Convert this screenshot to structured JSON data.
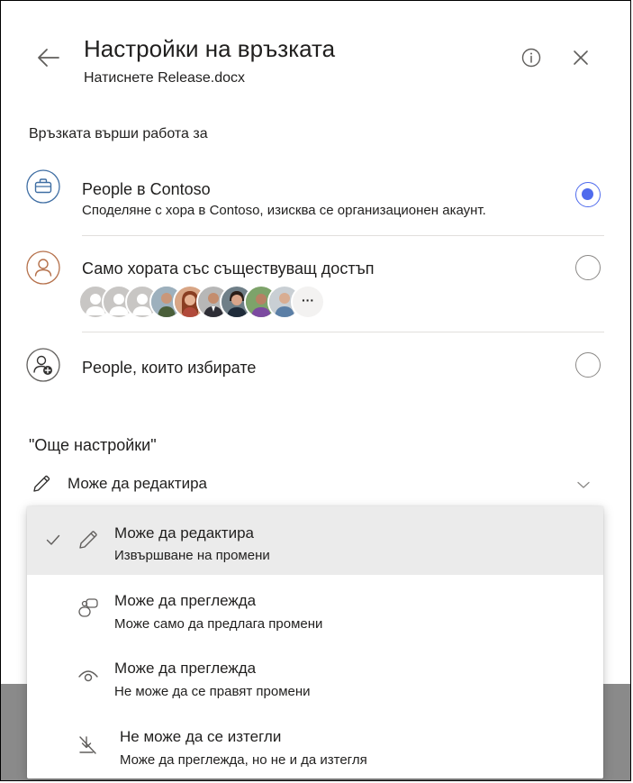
{
  "dialog": {
    "title": "Настройки на връзката",
    "subtitle": "Натиснете Release.docx",
    "back_icon": "arrow-left-icon",
    "info_icon": "info-icon",
    "close_icon": "close-icon"
  },
  "link_works_for": {
    "label": "Връзката върши работа за",
    "options": [
      {
        "icon": "briefcase-icon",
        "title": "People в Contoso",
        "description": "Споделяне с хора в Contoso, изисква се организационен акаунт.",
        "selected": true
      },
      {
        "icon": "person-icon",
        "title": "Само хората със съществуващ достъп",
        "description": "",
        "selected": false,
        "avatars": [
          "placeholder",
          "placeholder",
          "placeholder",
          "person",
          "person",
          "person",
          "person",
          "person",
          "person",
          "more"
        ],
        "more_label": "···"
      },
      {
        "icon": "person-add-icon",
        "title": "People, които избирате",
        "description": "",
        "selected": false
      }
    ]
  },
  "more_settings": {
    "label": "\"Още настройки\"",
    "permission_icon": "pencil-icon",
    "permission_value": "Може да редактира",
    "dropdown_icon": "chevron-down-icon"
  },
  "permission_menu": {
    "items": [
      {
        "icon": "pencil-icon",
        "title": "Може да редактира",
        "description": "Извършване на промени",
        "selected": true
      },
      {
        "icon": "review-icon",
        "title": "Може да преглежда",
        "description": "Може само да предлага промени",
        "selected": false
      },
      {
        "icon": "eye-icon",
        "title": "Може да преглежда",
        "description": "Не може да се правят промени",
        "selected": false
      },
      {
        "icon": "block-download-icon",
        "title": "Не може да се изтегли",
        "description": "Може да преглежда, но не и да изтегля",
        "selected": false
      }
    ]
  },
  "colors": {
    "accent": "#4f6bed",
    "text": "#201f1e",
    "divider": "#e1dfdd",
    "selected_bg": "#ebebeb",
    "icon_blue": "#3f6ea3",
    "icon_orange": "#b5704a"
  }
}
